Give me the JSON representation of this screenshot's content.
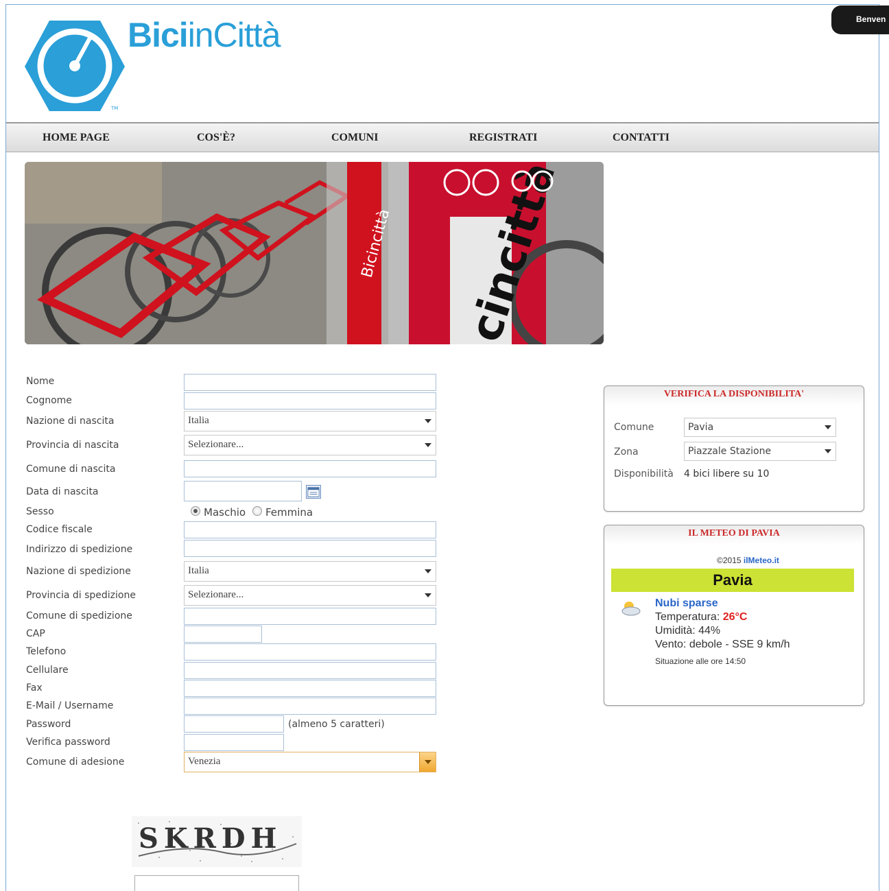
{
  "header": {
    "brand_bold": "Bici",
    "brand_mid": "in",
    "brand_rest": "Città",
    "welcome": "Benven"
  },
  "nav": {
    "items": [
      "HOME PAGE",
      "COS'È?",
      "COMUNI",
      "REGISTRATI",
      "CONTATTI"
    ]
  },
  "form": {
    "labels": {
      "nome": "Nome",
      "cognome": "Cognome",
      "nazione_nascita": "Nazione di nascita",
      "provincia_nascita": "Provincia di nascita",
      "comune_nascita": "Comune di nascita",
      "data_nascita": "Data di nascita",
      "sesso": "Sesso",
      "codice_fiscale": "Codice fiscale",
      "indirizzo": "Indirizzo di spedizione",
      "nazione_spedizione": "Nazione di spedizione",
      "provincia_spedizione": "Provincia di spedizione",
      "comune_spedizione": "Comune di spedizione",
      "cap": "CAP",
      "telefono": "Telefono",
      "cellulare": "Cellulare",
      "fax": "Fax",
      "email": "E-Mail / Username",
      "password": "Password",
      "verifica_password": "Verifica password",
      "comune_adesione": "Comune di adesione"
    },
    "values": {
      "nazione_nascita": "Italia",
      "provincia_nascita": "Selezionare...",
      "nazione_spedizione": "Italia",
      "provincia_spedizione": "Selezionare...",
      "comune_adesione": "Venezia"
    },
    "sesso_options": [
      "Maschio",
      "Femmina"
    ],
    "password_hint": "(almeno 5 caratteri)",
    "captcha_text": "SKRDH"
  },
  "availability": {
    "title": "VERIFICA LA DISPONIBILITA'",
    "comune_label": "Comune",
    "comune_value": "Pavia",
    "zona_label": "Zona",
    "zona_value": "Piazzale Stazione",
    "disp_label": "Disponibilità",
    "disp_value": "4 bici libere su 10"
  },
  "meteo": {
    "title": "IL METEO DI PAVIA",
    "copyright": "©2015",
    "copyright_link": "ilMeteo.it",
    "city": "Pavia",
    "condition": "Nubi sparse",
    "temp_label": "Temperatura:",
    "temp_value": "26°C",
    "humidity": "Umidità: 44%",
    "wind": "Vento: debole - SSE 9 km/h",
    "updated": "Situazione alle ore 14:50"
  },
  "colors": {
    "brand": "#2a9fd8",
    "accent_red": "#cc2a2a",
    "meteo_bar": "#cce234",
    "link_blue": "#2a66c8"
  }
}
